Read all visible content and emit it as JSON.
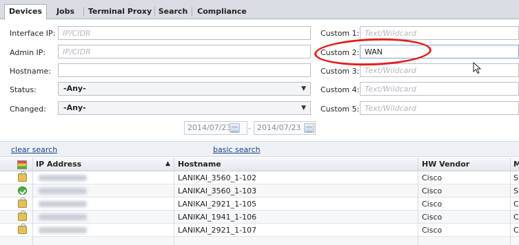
{
  "tabs": [
    {
      "label": "Devices",
      "active": true
    },
    {
      "label": "Jobs",
      "active": false
    },
    {
      "label": "Terminal Proxy",
      "active": false
    },
    {
      "label": "Search",
      "active": false
    },
    {
      "label": "Compliance",
      "active": false
    }
  ],
  "form": {
    "interface_ip": {
      "label": "Interface IP:",
      "placeholder": "IP/CIDR",
      "value": ""
    },
    "admin_ip": {
      "label": "Admin IP:",
      "placeholder": "IP/CIDR",
      "value": ""
    },
    "hostname": {
      "label": "Hostname:",
      "value": ""
    },
    "status": {
      "label": "Status:",
      "value": "-Any-"
    },
    "changed": {
      "label": "Changed:",
      "value": "-Any-"
    },
    "custom1": {
      "label": "Custom 1:",
      "placeholder": "Text/Wildcard",
      "value": ""
    },
    "custom2": {
      "label": "Custom 2:",
      "placeholder": "Text/Wildcard",
      "value": "WAN"
    },
    "custom3": {
      "label": "Custom 3:",
      "placeholder": "Text/Wildcard",
      "value": ""
    },
    "custom4": {
      "label": "Custom 4:",
      "placeholder": "Text/Wildcard",
      "value": ""
    },
    "custom5": {
      "label": "Custom 5:",
      "placeholder": "Text/Wildcard",
      "value": ""
    },
    "date_from": "2014/07/23",
    "date_separator": "-",
    "date_to": "2014/07/23"
  },
  "links": {
    "clear": "clear search",
    "basic": "basic search"
  },
  "table": {
    "columns": {
      "ip": "IP Address",
      "sort_indicator": "▲",
      "hostname": "Hostname",
      "vendor": "HW Vendor",
      "next": "M"
    },
    "rows": [
      {
        "status_icon": "lock-icon",
        "hostname": "LANIKAI_3560_1-102",
        "vendor": "Cisco",
        "next": "S"
      },
      {
        "status_icon": "check-icon",
        "hostname": "LANIKAI_3560_1-103",
        "vendor": "Cisco",
        "next": "S"
      },
      {
        "status_icon": "lock-icon",
        "hostname": "LANIKAI_2921_1-105",
        "vendor": "Cisco",
        "next": "C"
      },
      {
        "status_icon": "lock-icon",
        "hostname": "LANIKAI_1941_1-106",
        "vendor": "Cisco",
        "next": "C"
      },
      {
        "status_icon": "lock-icon",
        "hostname": "LANIKAI_2921_1-107",
        "vendor": "Cisco",
        "next": "C"
      }
    ]
  },
  "colors": {
    "annotation": "#e0201c",
    "link": "#1a3e8c"
  }
}
